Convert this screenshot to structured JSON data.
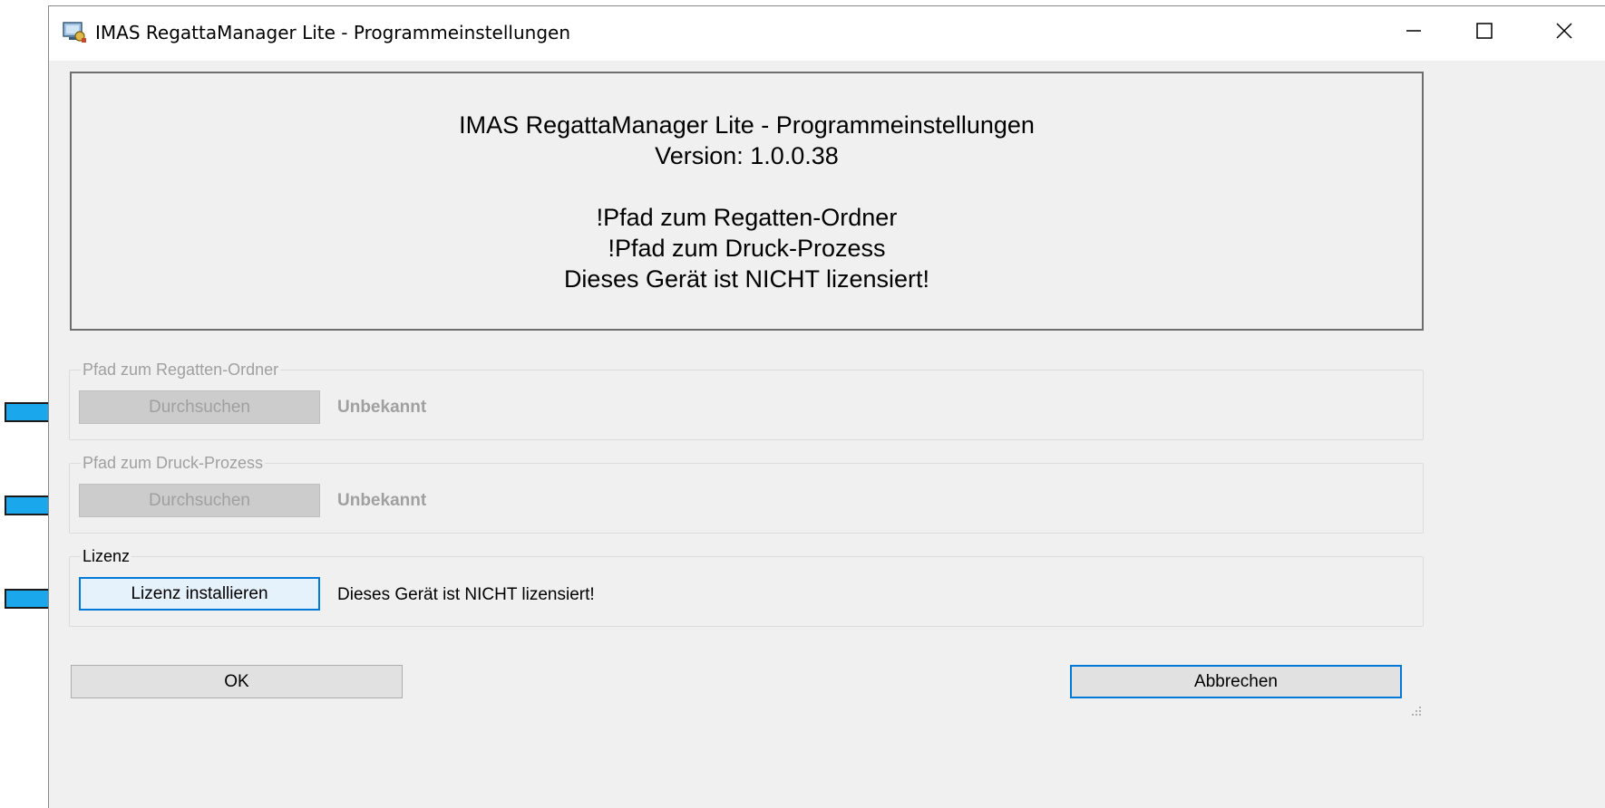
{
  "window": {
    "title": "IMAS RegattaManager Lite - Programmeinstellungen",
    "controls": [
      "minimize",
      "maximize",
      "close"
    ]
  },
  "info_panel": {
    "lines": [
      "IMAS RegattaManager Lite - Programmeinstellungen",
      "Version: 1.0.0.38",
      "",
      "!Pfad zum Regatten-Ordner",
      "!Pfad zum Druck-Prozess",
      "Dieses Gerät ist NICHT lizensiert!"
    ]
  },
  "groups": {
    "regatta_folder": {
      "legend": "Pfad zum Regatten-Ordner",
      "button_label": "Durchsuchen",
      "status": "Unbekannt",
      "enabled": false
    },
    "print_process": {
      "legend": "Pfad zum Druck-Prozess",
      "button_label": "Durchsuchen",
      "status": "Unbekannt",
      "enabled": false
    },
    "license": {
      "legend": "Lizenz",
      "button_label": "Lizenz installieren",
      "status": "Dieses Gerät ist NICHT lizensiert!",
      "enabled": true
    }
  },
  "footer": {
    "ok_label": "OK",
    "cancel_label": "Abbrechen"
  },
  "annotations": {
    "arrow_color": "#1aa7ec",
    "arrow_count": 3
  },
  "colors": {
    "window_bg": "#f0f0f0",
    "accent": "#0078d7",
    "disabled_text": "#a0a0a0"
  }
}
